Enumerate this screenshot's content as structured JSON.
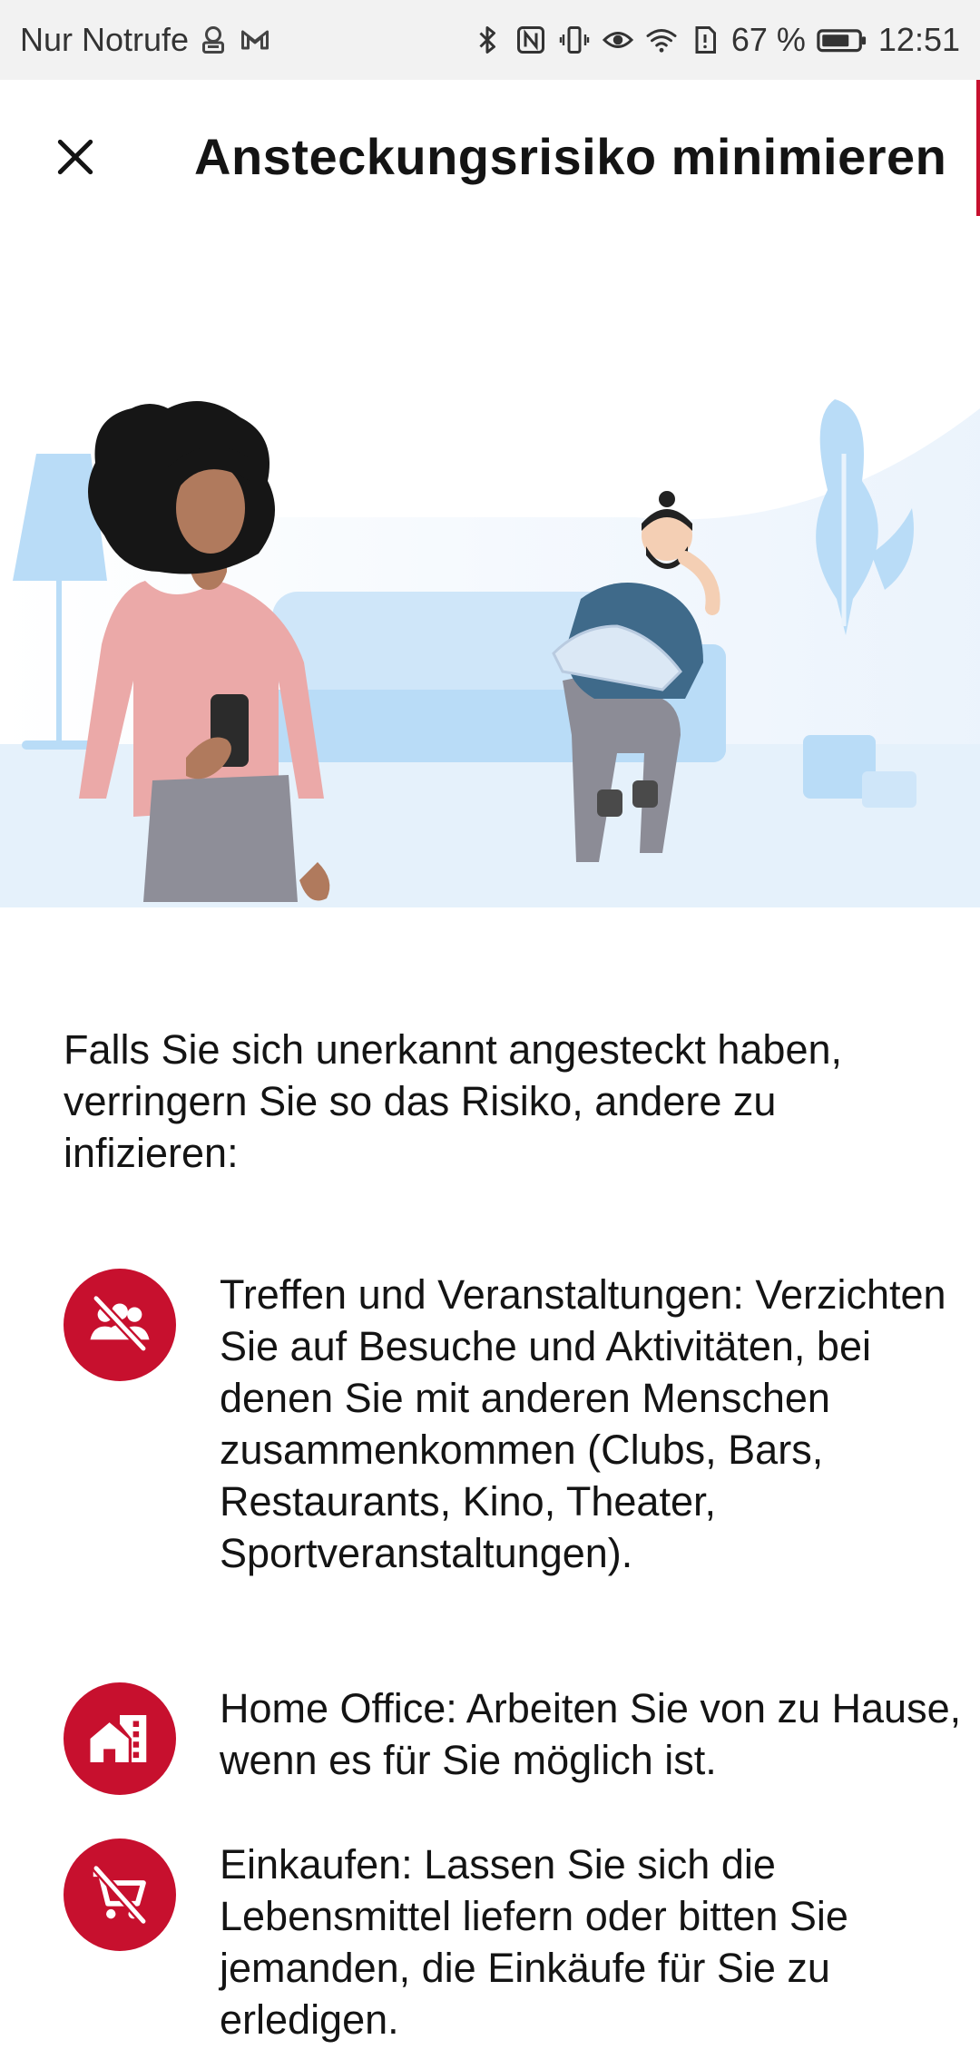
{
  "status_bar": {
    "carrier": "Nur Notrufe",
    "battery": "67 %",
    "time": "12:51",
    "left_icons": [
      "vpn-key-icon",
      "gmail-icon"
    ],
    "right_icons": [
      "bluetooth-icon",
      "nfc-icon",
      "vibrate-icon",
      "eye-comfort-icon",
      "wifi-icon",
      "battery-alert-icon",
      "battery-icon"
    ]
  },
  "header": {
    "close_icon": "close-icon",
    "title": "Ansteckungsrisiko minimieren"
  },
  "intro": "Falls Sie sich unerkannt angesteckt haben, verringern Sie so das Risiko, andere zu infizieren:",
  "tips": [
    {
      "icon": "no-gatherings-icon",
      "text": "Treffen und Veranstaltungen: Verzichten Sie auf Besuche und Aktivitäten, bei denen Sie mit anderen Menschen zusammenkommen (Clubs, Bars, Restaurants, Kino, Theater, Sportveranstaltungen)."
    },
    {
      "icon": "home-office-icon",
      "text": "Home Office: Arbeiten Sie von zu Hause, wenn es für Sie möglich ist."
    },
    {
      "icon": "no-shopping-cart-icon",
      "text": "Einkaufen: Lassen Sie sich die Lebensmittel liefern oder bitten Sie jemanden, die Einkäufe für Sie zu erledigen."
    }
  ],
  "colors": {
    "accent": "#c7102e",
    "text": "#141414",
    "statusbar_bg": "#f2f2f2",
    "illustration_bg": "#e8f2fc",
    "illustration_furniture": "#b9dcf7"
  }
}
